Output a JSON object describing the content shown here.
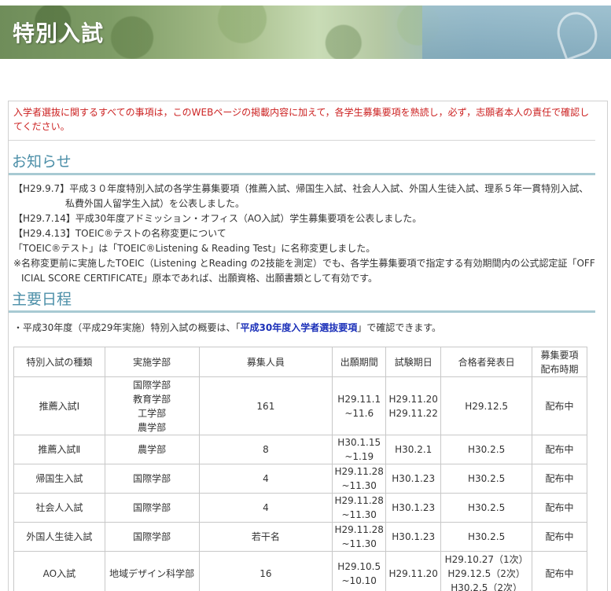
{
  "banner": {
    "title": "特別入試"
  },
  "notice": "入学者選抜に関するすべての事項は，このWEBページの掲載内容に加えて，各学生募集要項を熟読し，必ず，志願者本人の責任で確認してください。",
  "news_heading": "お知らせ",
  "news": [
    {
      "text": "【H29.9.7】平成３０年度特別入試の各学生募集要項（推薦入試、帰国生入試、社会人入試、外国人生徒入試、理系５年一貫特別入試、",
      "indent": false
    },
    {
      "text": "私費外国人留学生入試）を公表しました。",
      "indent": true
    },
    {
      "text": "【H29.7.14】平成30年度アドミッション・オフィス（AO入試）学生募集要項を公表しました。",
      "indent": false
    },
    {
      "text": "【H29.4.13】TOEIC®テストの名称変更について",
      "indent": false
    },
    {
      "text": "「TOEIC®テスト」は「TOEIC®Listening & Reading Test」に名称変更しました。",
      "indent": false
    },
    {
      "text": "※名称変更前に実施したTOEIC（Listening とReading の2技能を測定）でも、各学生募集要項で指定する有効期間内の公式認定証「OFF",
      "indent": false
    },
    {
      "text": "ICIAL SCORE CERTIFICATE」原本であれば、出願資格、出願書類として有効です。",
      "indent2": true
    }
  ],
  "schedule_heading": "主要日程",
  "lead": {
    "prefix": "・平成30年度（平成29年実施）特別入試の概要は、「",
    "link": "平成30年度入学者選抜要項",
    "suffix": "」で確認できます。"
  },
  "table": {
    "headers": [
      "特別入試の種類",
      "実施学部",
      "募集人員",
      "出願期間",
      "試験期日",
      "合格者発表日",
      "募集要項\n配布時期"
    ],
    "rows": [
      {
        "type": "推薦入試Ⅰ",
        "faculty": "国際学部\n教育学部\n工学部\n農学部",
        "capacity": "161",
        "period": "H29.11.1\n~11.6",
        "exam": "H29.11.20\nH29.11.22",
        "announce": "H29.12.5",
        "dist": "配布中",
        "h": 74
      },
      {
        "type": "推薦入試Ⅱ",
        "faculty": "農学部",
        "capacity": "8",
        "period": "H30.1.15\n~1.19",
        "exam": "H30.2.1",
        "announce": "H30.2.5",
        "dist": "配布中",
        "h": 37
      },
      {
        "type": "帰国生入試",
        "faculty": "国際学部",
        "capacity": "4",
        "period": "H29.11.28\n~11.30",
        "exam": "H30.1.23",
        "announce": "H30.2.5",
        "dist": "配布中",
        "h": 37
      },
      {
        "type": "社会人入試",
        "faculty": "国際学部",
        "capacity": "4",
        "period": "H29.11.28\n~11.30",
        "exam": "H30.1.23",
        "announce": "H30.2.5",
        "dist": "配布中",
        "h": 37
      },
      {
        "type": "外国人生徒入試",
        "faculty": "国際学部",
        "capacity": "若干名",
        "period": "H29.11.28\n~11.30",
        "exam": "H30.1.23",
        "announce": "H30.2.5",
        "dist": "配布中",
        "h": 37
      },
      {
        "type": "AO入試",
        "faculty": "地域デザイン科学部",
        "capacity": "16",
        "period": "H29.10.5\n~10.10",
        "exam": "H29.11.20",
        "announce": "H29.10.27（1次）\nH29.12.5（2次）\nH30.2.5（2次）",
        "dist": "配布中",
        "h": 56
      }
    ]
  }
}
